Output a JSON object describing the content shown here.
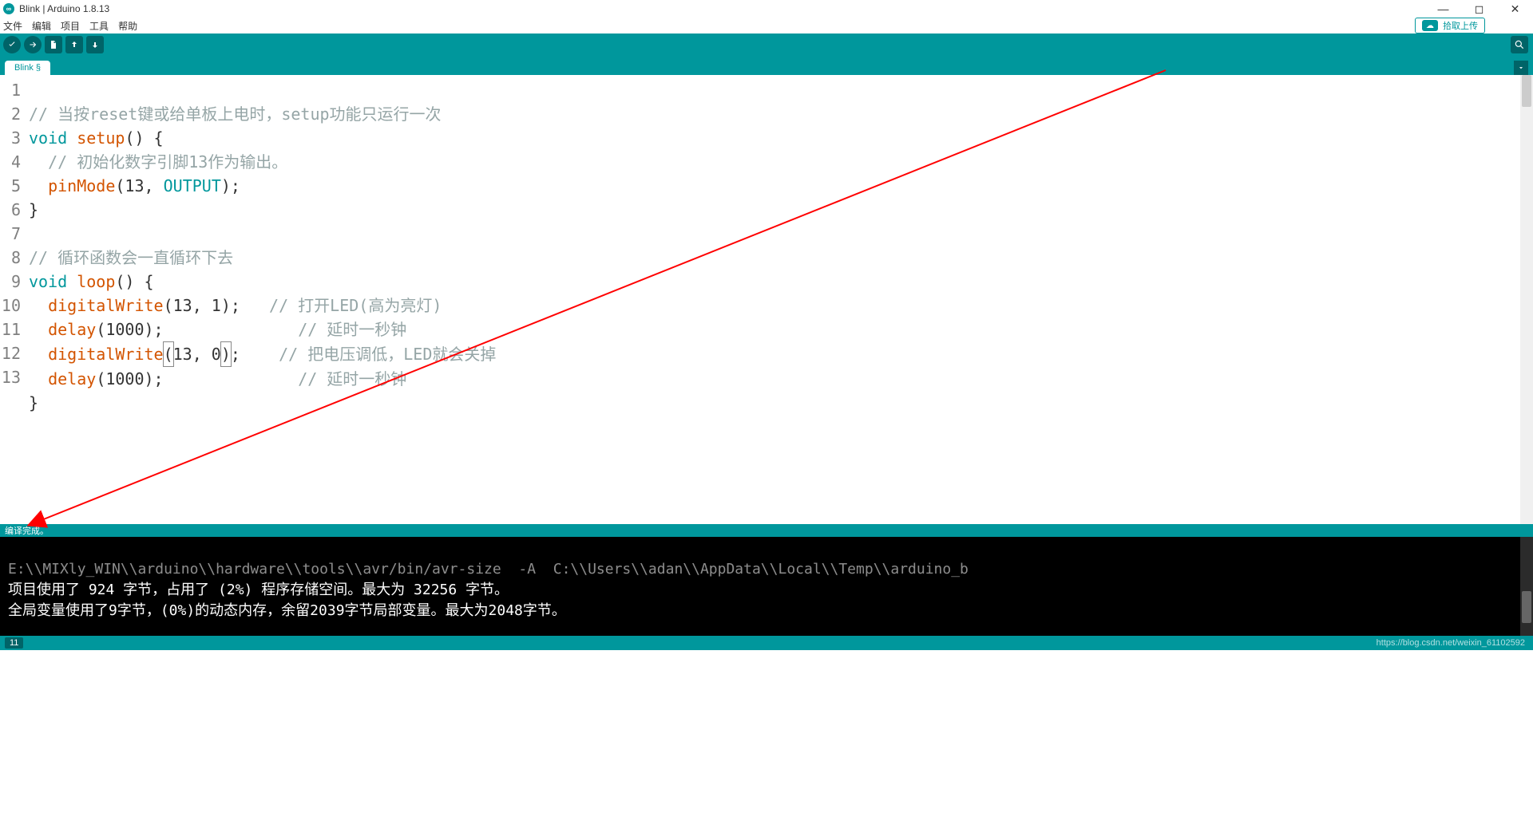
{
  "window": {
    "title": "Blink | Arduino 1.8.13"
  },
  "menu": {
    "file": "文件",
    "edit": "编辑",
    "sketch": "项目",
    "tools": "工具",
    "help": "帮助"
  },
  "cloud": {
    "label": "拾取上传"
  },
  "tab": {
    "name": "Blink §"
  },
  "code": {
    "lines": [
      "1",
      "2",
      "3",
      "4",
      "5",
      "6",
      "7",
      "8",
      "9",
      "10",
      "11",
      "12",
      "13"
    ],
    "l1_comment": "// 当按reset键或给单板上电时，setup功能只运行一次",
    "l2_void": "void",
    "l2_setup": "setup",
    "l2_rest": "() {",
    "l3_comment": "// 初始化数字引脚13作为输出。",
    "l4_pinmode": "pinMode",
    "l4_args": "(13, ",
    "l4_output": "OUTPUT",
    "l4_end": ");",
    "l5": "}",
    "l6": "",
    "l7_comment": "// 循环函数会一直循环下去",
    "l8_void": "void",
    "l8_loop": "loop",
    "l8_rest": "() {",
    "l9_dw": "digitalWrite",
    "l9_args": "(13, 1);",
    "l9_cm": "// 打开LED(高为亮灯)",
    "l10_delay": "delay",
    "l10_args": "(1000);",
    "l10_cm": "// 延时一秒钟",
    "l11_dw": "digitalWrite",
    "l11_open": "(",
    "l11_mid": "13, 0",
    "l11_close": ")",
    "l11_end": ";",
    "l11_cm": "// 把电压调低，LED就会关掉",
    "l12_delay": "delay",
    "l12_args": "(1000);",
    "l12_cm": "// 延时一秒钟",
    "l13": "}"
  },
  "status": {
    "msg": "编译完成。"
  },
  "console": {
    "l1": "E:\\\\MIXly_WIN\\\\arduino\\\\hardware\\\\tools\\\\avr/bin/avr-size  -A  C:\\\\Users\\\\adan\\\\AppData\\\\Local\\\\Temp\\\\arduino_b",
    "l2": "项目使用了 924 字节，占用了 (2%) 程序存储空间。最大为 32256 字节。",
    "l3": "全局变量使用了9字节，(0%)的动态内存，余留2039字节局部变量。最大为2048字节。"
  },
  "footer": {
    "line": "11",
    "watermark": "https://blog.csdn.net/weixin_61102592"
  }
}
